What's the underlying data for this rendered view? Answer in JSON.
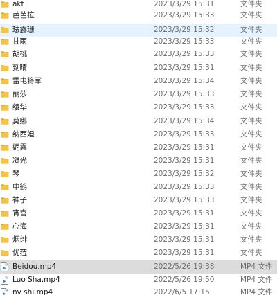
{
  "files": [
    {
      "name": "akt",
      "date": "2023/3/29 15:31",
      "type": "文件夹",
      "icon": "folder-icon",
      "state": ""
    },
    {
      "name": "芭芭拉",
      "date": "2023/3/29 15:33",
      "type": "文件夹",
      "icon": "folder-icon",
      "state": ""
    },
    {
      "name": "珐露珊",
      "date": "2023/3/29 15:32",
      "type": "文件夹",
      "icon": "folder-icon",
      "state": "hovered"
    },
    {
      "name": "甘雨",
      "date": "2023/3/29 15:33",
      "type": "文件夹",
      "icon": "folder-icon",
      "state": ""
    },
    {
      "name": "胡桃",
      "date": "2023/3/29 15:33",
      "type": "文件夹",
      "icon": "folder-icon",
      "state": ""
    },
    {
      "name": "刻晴",
      "date": "2023/3/29 15:31",
      "type": "文件夹",
      "icon": "folder-icon",
      "state": ""
    },
    {
      "name": "雷电将军",
      "date": "2023/3/29 15:34",
      "type": "文件夹",
      "icon": "folder-icon",
      "state": ""
    },
    {
      "name": "丽莎",
      "date": "2023/3/29 15:33",
      "type": "文件夹",
      "icon": "folder-icon",
      "state": ""
    },
    {
      "name": "绫华",
      "date": "2023/3/29 15:33",
      "type": "文件夹",
      "icon": "folder-icon",
      "state": ""
    },
    {
      "name": "莫娜",
      "date": "2023/3/29 15:34",
      "type": "文件夹",
      "icon": "folder-icon",
      "state": ""
    },
    {
      "name": "纳西妲",
      "date": "2023/3/29 15:33",
      "type": "文件夹",
      "icon": "folder-icon",
      "state": ""
    },
    {
      "name": "妮露",
      "date": "2023/3/29 15:31",
      "type": "文件夹",
      "icon": "folder-icon",
      "state": ""
    },
    {
      "name": "凝光",
      "date": "2023/3/29 15:31",
      "type": "文件夹",
      "icon": "folder-icon",
      "state": ""
    },
    {
      "name": "琴",
      "date": "2023/3/29 15:32",
      "type": "文件夹",
      "icon": "folder-icon",
      "state": ""
    },
    {
      "name": "申鹤",
      "date": "2023/3/29 15:33",
      "type": "文件夹",
      "icon": "folder-icon",
      "state": ""
    },
    {
      "name": "神子",
      "date": "2023/3/29 15:33",
      "type": "文件夹",
      "icon": "folder-icon",
      "state": ""
    },
    {
      "name": "宵宫",
      "date": "2023/3/29 15:31",
      "type": "文件夹",
      "icon": "folder-icon",
      "state": ""
    },
    {
      "name": "心海",
      "date": "2023/3/29 15:31",
      "type": "文件夹",
      "icon": "folder-icon",
      "state": ""
    },
    {
      "name": "烟绯",
      "date": "2023/3/29 15:31",
      "type": "文件夹",
      "icon": "folder-icon",
      "state": ""
    },
    {
      "name": "优菈",
      "date": "2023/3/29 15:31",
      "type": "文件夹",
      "icon": "folder-icon",
      "state": ""
    },
    {
      "name": "Beidou.mp4",
      "date": "2022/5/26 19:38",
      "type": "MP4 文件",
      "icon": "video-file-icon",
      "state": "selected"
    },
    {
      "name": "Luo Sha.mp4",
      "date": "2022/5/26 19:50",
      "type": "MP4 文件",
      "icon": "video-file-icon",
      "state": ""
    },
    {
      "name": "nv shi.mp4",
      "date": "2022/6/5 17:15",
      "type": "MP4 文件",
      "icon": "video-file-icon",
      "state": ""
    }
  ],
  "colors": {
    "folder": "#f5c542",
    "folder_dark": "#e2a92a",
    "selected_bg": "#dcdcdc",
    "hover_bg": "#e5f3ff",
    "file_icon_accent": "#2a7fd4"
  }
}
